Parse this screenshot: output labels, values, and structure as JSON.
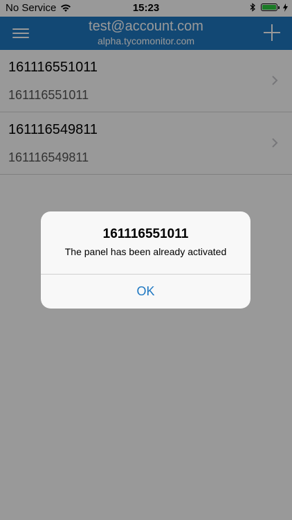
{
  "status_bar": {
    "carrier": "No Service",
    "time": "15:23",
    "icons": [
      "wifi-icon",
      "bluetooth-icon",
      "battery-icon",
      "charging-icon"
    ]
  },
  "header": {
    "title": "test@account.com",
    "subtitle": "alpha.tycomonitor.com",
    "menu_icon": "hamburger-menu-icon",
    "add_icon": "plus-icon",
    "background_color": "#1f78c2"
  },
  "list": {
    "items": [
      {
        "title": "161116551011",
        "subtitle": "161116551011"
      },
      {
        "title": "161116549811",
        "subtitle": "161116549811"
      }
    ]
  },
  "alert": {
    "title": "161116551011",
    "message": "The panel has been already activated",
    "ok_label": "OK",
    "accent_color": "#1f78c2"
  }
}
